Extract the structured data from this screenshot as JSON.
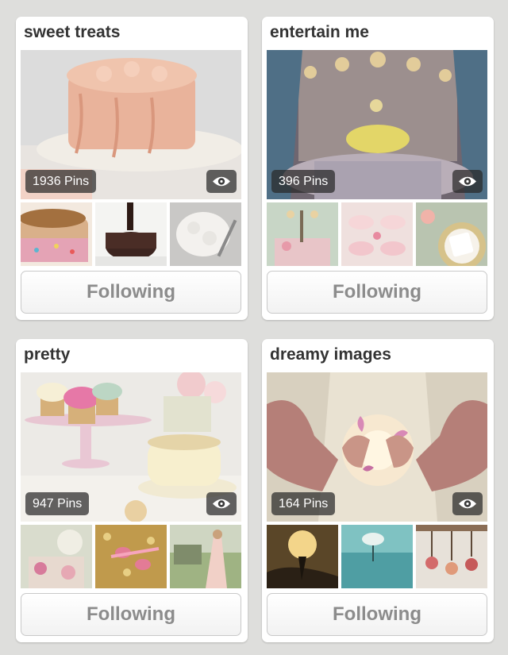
{
  "boards": [
    {
      "title": "sweet treats",
      "pins": "1936 Pins",
      "follow_label": "Following"
    },
    {
      "title": "entertain me",
      "pins": "396 Pins",
      "follow_label": "Following"
    },
    {
      "title": "pretty",
      "pins": "947 Pins",
      "follow_label": "Following"
    },
    {
      "title": "dreamy images",
      "pins": "164 Pins",
      "follow_label": "Following"
    }
  ],
  "icons": {
    "preview": "eye-icon"
  },
  "colors": {
    "background": "#dededc",
    "card": "#ffffff",
    "title": "#333333",
    "button_text": "#8c8c8c"
  }
}
